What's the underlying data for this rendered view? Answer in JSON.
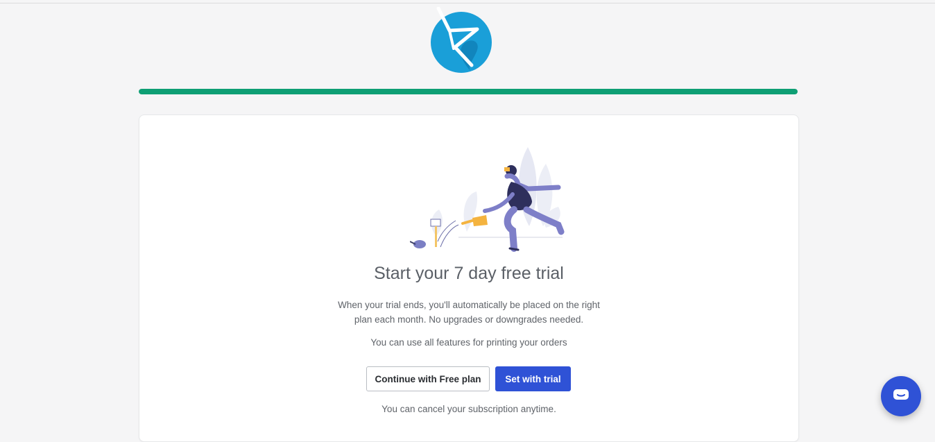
{
  "brand": {
    "logo_icon": "brand-logo-icon",
    "logo_color": "#1a9fd8"
  },
  "progress": {
    "value_percent": 100,
    "color": "#0e9f74"
  },
  "card": {
    "title": "Start your 7 day free trial",
    "description": "When your trial ends, you'll automatically be placed on the right plan each month. No upgrades or downgrades needed.",
    "features_note": "You can use all features for printing your orders",
    "free_plan_button": "Continue with Free plan",
    "trial_button": "Set with trial",
    "cancel_note": "You can cancel your subscription anytime."
  },
  "chat": {
    "icon": "chat-icon",
    "color": "#2f52d6"
  }
}
